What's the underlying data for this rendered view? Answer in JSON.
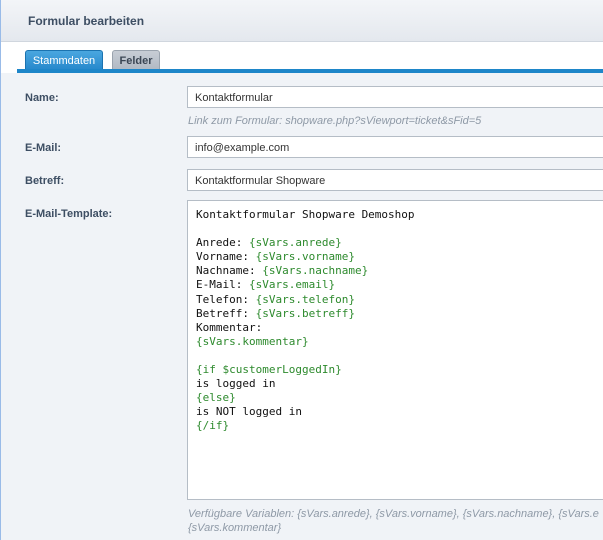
{
  "window": {
    "title": "Formular bearbeiten"
  },
  "tabs": [
    {
      "label": "Stammdaten",
      "active": true
    },
    {
      "label": "Felder",
      "active": false
    }
  ],
  "form": {
    "name": {
      "label": "Name:",
      "value": "Kontaktformular",
      "hint": "Link zum Formular: shopware.php?sViewport=ticket&sFid=5"
    },
    "email": {
      "label": "E-Mail:",
      "value": "info@example.com"
    },
    "subject": {
      "label": "Betreff:",
      "value": "Kontaktformular Shopware"
    },
    "template": {
      "label": "E-Mail-Template:",
      "lines": [
        {
          "plain": "Kontaktformular Shopware Demoshop",
          "tpl": ""
        },
        {
          "plain": "",
          "tpl": ""
        },
        {
          "plain": "Anrede: ",
          "tpl": "{sVars.anrede}"
        },
        {
          "plain": "Vorname: ",
          "tpl": "{sVars.vorname}"
        },
        {
          "plain": "Nachname: ",
          "tpl": "{sVars.nachname}"
        },
        {
          "plain": "E-Mail: ",
          "tpl": "{sVars.email}"
        },
        {
          "plain": "Telefon: ",
          "tpl": "{sVars.telefon}"
        },
        {
          "plain": "Betreff: ",
          "tpl": "{sVars.betreff}"
        },
        {
          "plain": "Kommentar:",
          "tpl": ""
        },
        {
          "plain": "",
          "tpl": "{sVars.kommentar}"
        },
        {
          "plain": "",
          "tpl": ""
        },
        {
          "plain": "",
          "tpl": "{if $customerLoggedIn}"
        },
        {
          "plain": "is logged in",
          "tpl": ""
        },
        {
          "plain": "",
          "tpl": "{else}"
        },
        {
          "plain": "is NOT logged in",
          "tpl": ""
        },
        {
          "plain": "",
          "tpl": "{/if}"
        }
      ],
      "hint_line1": "Verfügbare Variablen: {sVars.anrede}, {sVars.vorname}, {sVars.nachname}, {sVars.e",
      "hint_line2": "{sVars.kommentar}"
    }
  },
  "colors": {
    "accent": "#2284c9",
    "template_var": "#2d8a2d"
  }
}
